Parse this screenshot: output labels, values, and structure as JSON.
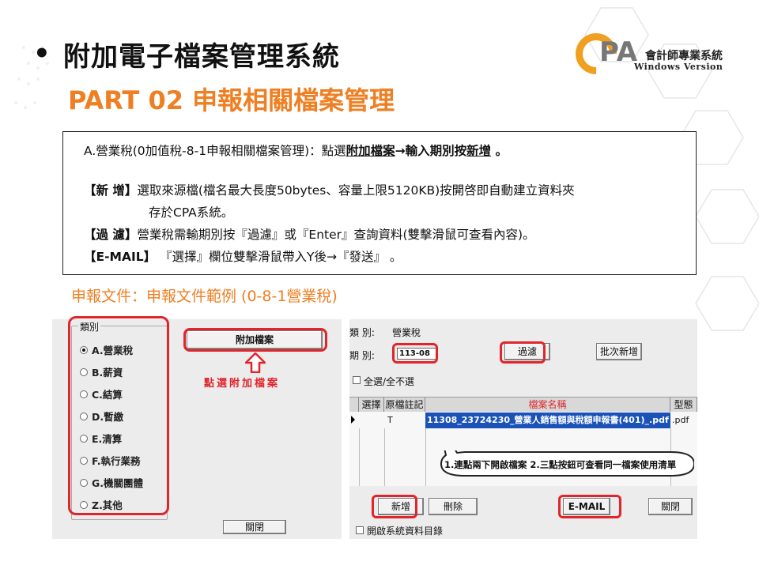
{
  "slide": {
    "bullet": "•",
    "title": "附加電子檔案管理系統",
    "subtitle": "PART 02 申報相關檔案管理"
  },
  "logo": {
    "letters": "PA",
    "name_zh": "會計師專業系統",
    "name_en": "Windows Version",
    "accent_color": "#f0a020"
  },
  "info": {
    "line_a_prefix": "A.營業稅(0加值稅-8-1申報相關檔案管理)：點選",
    "line_a_link1": "附加檔案",
    "line_a_mid": "→輸入期別按",
    "line_a_link2": "新增",
    "line_a_suffix": " 。",
    "new_tag": "【新  增】",
    "new_text": "選取來源檔(檔名最大長度50bytes、容量上限5120KB)按開啓即自動建立資料夾",
    "new_text2": "存於CPA系統。",
    "filter_tag": "【過  濾】",
    "filter_text": "營業稅需輸期別按『過濾』或『Enter』查詢資料(雙擊滑鼠可查看內容)。",
    "email_tag": "【E-MAIL】",
    "email_text": " 『選擇』欄位雙擊滑鼠帶入Y後→『發送』 。"
  },
  "example_caption": "申報文件：申報文件範例 (0-8-1營業稅)",
  "left_panel": {
    "group_label": "類別",
    "categories": [
      {
        "label": "A.營業稅",
        "selected": true
      },
      {
        "label": "B.薪資",
        "selected": false
      },
      {
        "label": "C.結算",
        "selected": false
      },
      {
        "label": "D.暫繳",
        "selected": false
      },
      {
        "label": "E.清算",
        "selected": false
      },
      {
        "label": "F.執行業務",
        "selected": false
      },
      {
        "label": "G.機關團體",
        "selected": false
      },
      {
        "label": "Z.其他",
        "selected": false
      }
    ],
    "attach_button": "附加檔案",
    "click_hint": "點選附加檔案",
    "close_button": "關閉"
  },
  "right_panel": {
    "category_label": "類  別:",
    "category_value": "營業稅",
    "period_label": "期  別:",
    "period_value": "113-08",
    "filter_button": "過濾",
    "batch_add_button": "批次新增",
    "select_all_label": "全選/全不選",
    "grid": {
      "headers": [
        "選擇",
        "原檔註記",
        "檔案名稱",
        "型態"
      ],
      "row": {
        "select": "",
        "original_mark": "T",
        "file_name": "11308_23724230_營業人銷售額與稅額申報書(401)_.pdf",
        "type": ".pdf"
      }
    },
    "callout": "1.連點兩下開啟檔案 2.三點按鈕可查看同一檔案使用清單",
    "add_button": "新增",
    "delete_button": "刪除",
    "email_button": "E-MAIL",
    "close_button": "關閉",
    "open_dir_label": "開啟系統資料目錄"
  },
  "colors": {
    "accent_orange": "#ee7f22",
    "highlight_red": "#e0262c",
    "selection_blue": "#1a52b8"
  }
}
